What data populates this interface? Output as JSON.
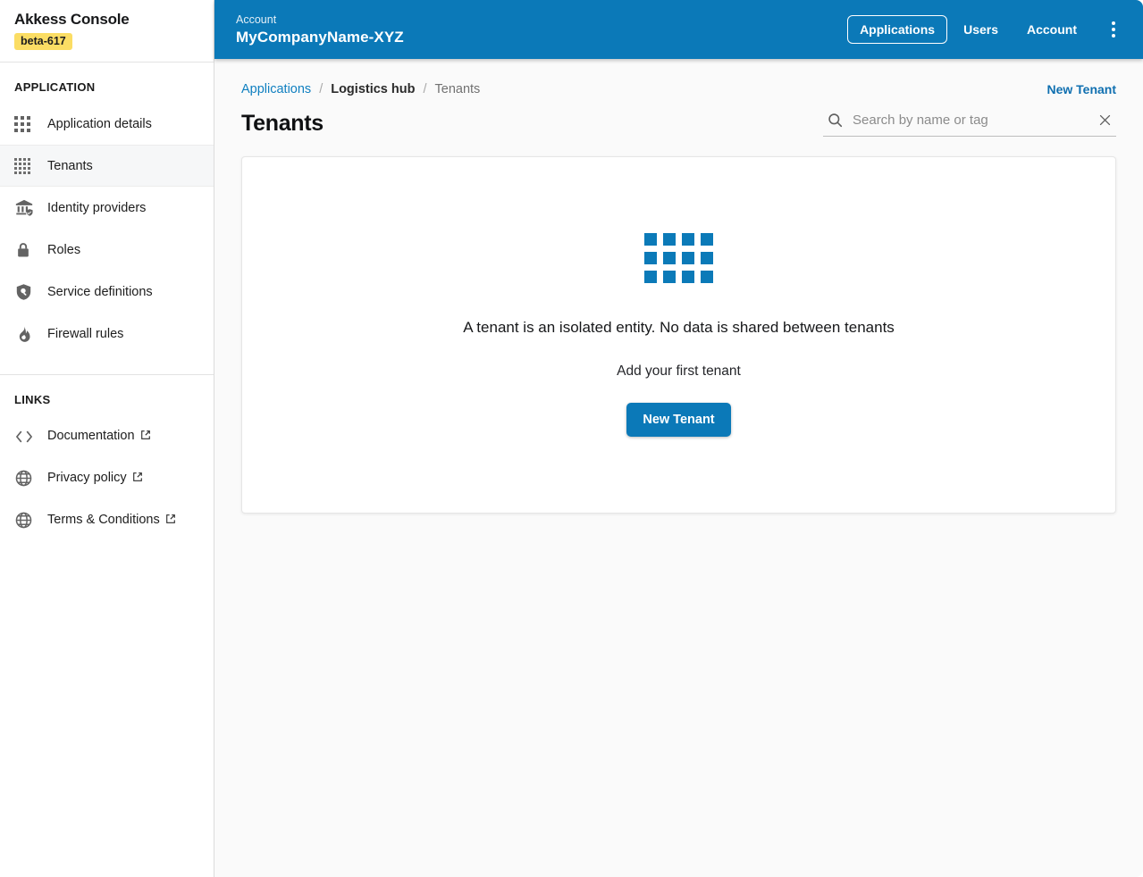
{
  "brand": {
    "name": "Akkess Console",
    "badge": "beta-617"
  },
  "sidebar": {
    "sections": [
      {
        "title": "APPLICATION",
        "items": [
          {
            "label": "Application details",
            "icon": "grid-3x3-icon",
            "active": false
          },
          {
            "label": "Tenants",
            "icon": "grid-4x4-icon",
            "active": true
          },
          {
            "label": "Identity providers",
            "icon": "bank-shield-icon",
            "active": false
          },
          {
            "label": "Roles",
            "icon": "lock-icon",
            "active": false
          },
          {
            "label": "Service definitions",
            "icon": "shield-search-icon",
            "active": false
          },
          {
            "label": "Firewall rules",
            "icon": "flame-icon",
            "active": false
          }
        ]
      },
      {
        "title": "LINKS",
        "items": [
          {
            "label": "Documentation",
            "icon": "code-brackets-icon",
            "external": true
          },
          {
            "label": "Privacy policy",
            "icon": "globe-icon",
            "external": true
          },
          {
            "label": "Terms & Conditions",
            "icon": "globe-icon",
            "external": true
          }
        ]
      }
    ]
  },
  "header": {
    "eyebrow": "Account",
    "title": "MyCompanyName-XYZ",
    "nav": [
      {
        "label": "Applications",
        "selected": true
      },
      {
        "label": "Users",
        "selected": false
      },
      {
        "label": "Account",
        "selected": false
      }
    ],
    "menu_icon": "kebab-menu-icon"
  },
  "breadcrumb": {
    "items": [
      {
        "label": "Applications",
        "type": "link"
      },
      {
        "label": "Logistics hub",
        "type": "current"
      },
      {
        "label": "Tenants",
        "type": "plain"
      }
    ],
    "separator": "/",
    "action": "New Tenant"
  },
  "page": {
    "title": "Tenants"
  },
  "search": {
    "placeholder": "Search by name or tag",
    "value": "",
    "search_icon": "search-icon",
    "clear_icon": "close-icon"
  },
  "empty_state": {
    "illustration": "grid-squares-illustration",
    "illustration_squares": 12,
    "headline": "A tenant is an isolated entity. No data is shared between tenants",
    "subtext": "Add your first tenant",
    "button": "New Tenant"
  },
  "colors": {
    "brand_blue": "#0b79b8",
    "link_blue": "#0f7fc0",
    "badge_yellow": "#fbdd64",
    "page_bg": "#fafafa"
  }
}
